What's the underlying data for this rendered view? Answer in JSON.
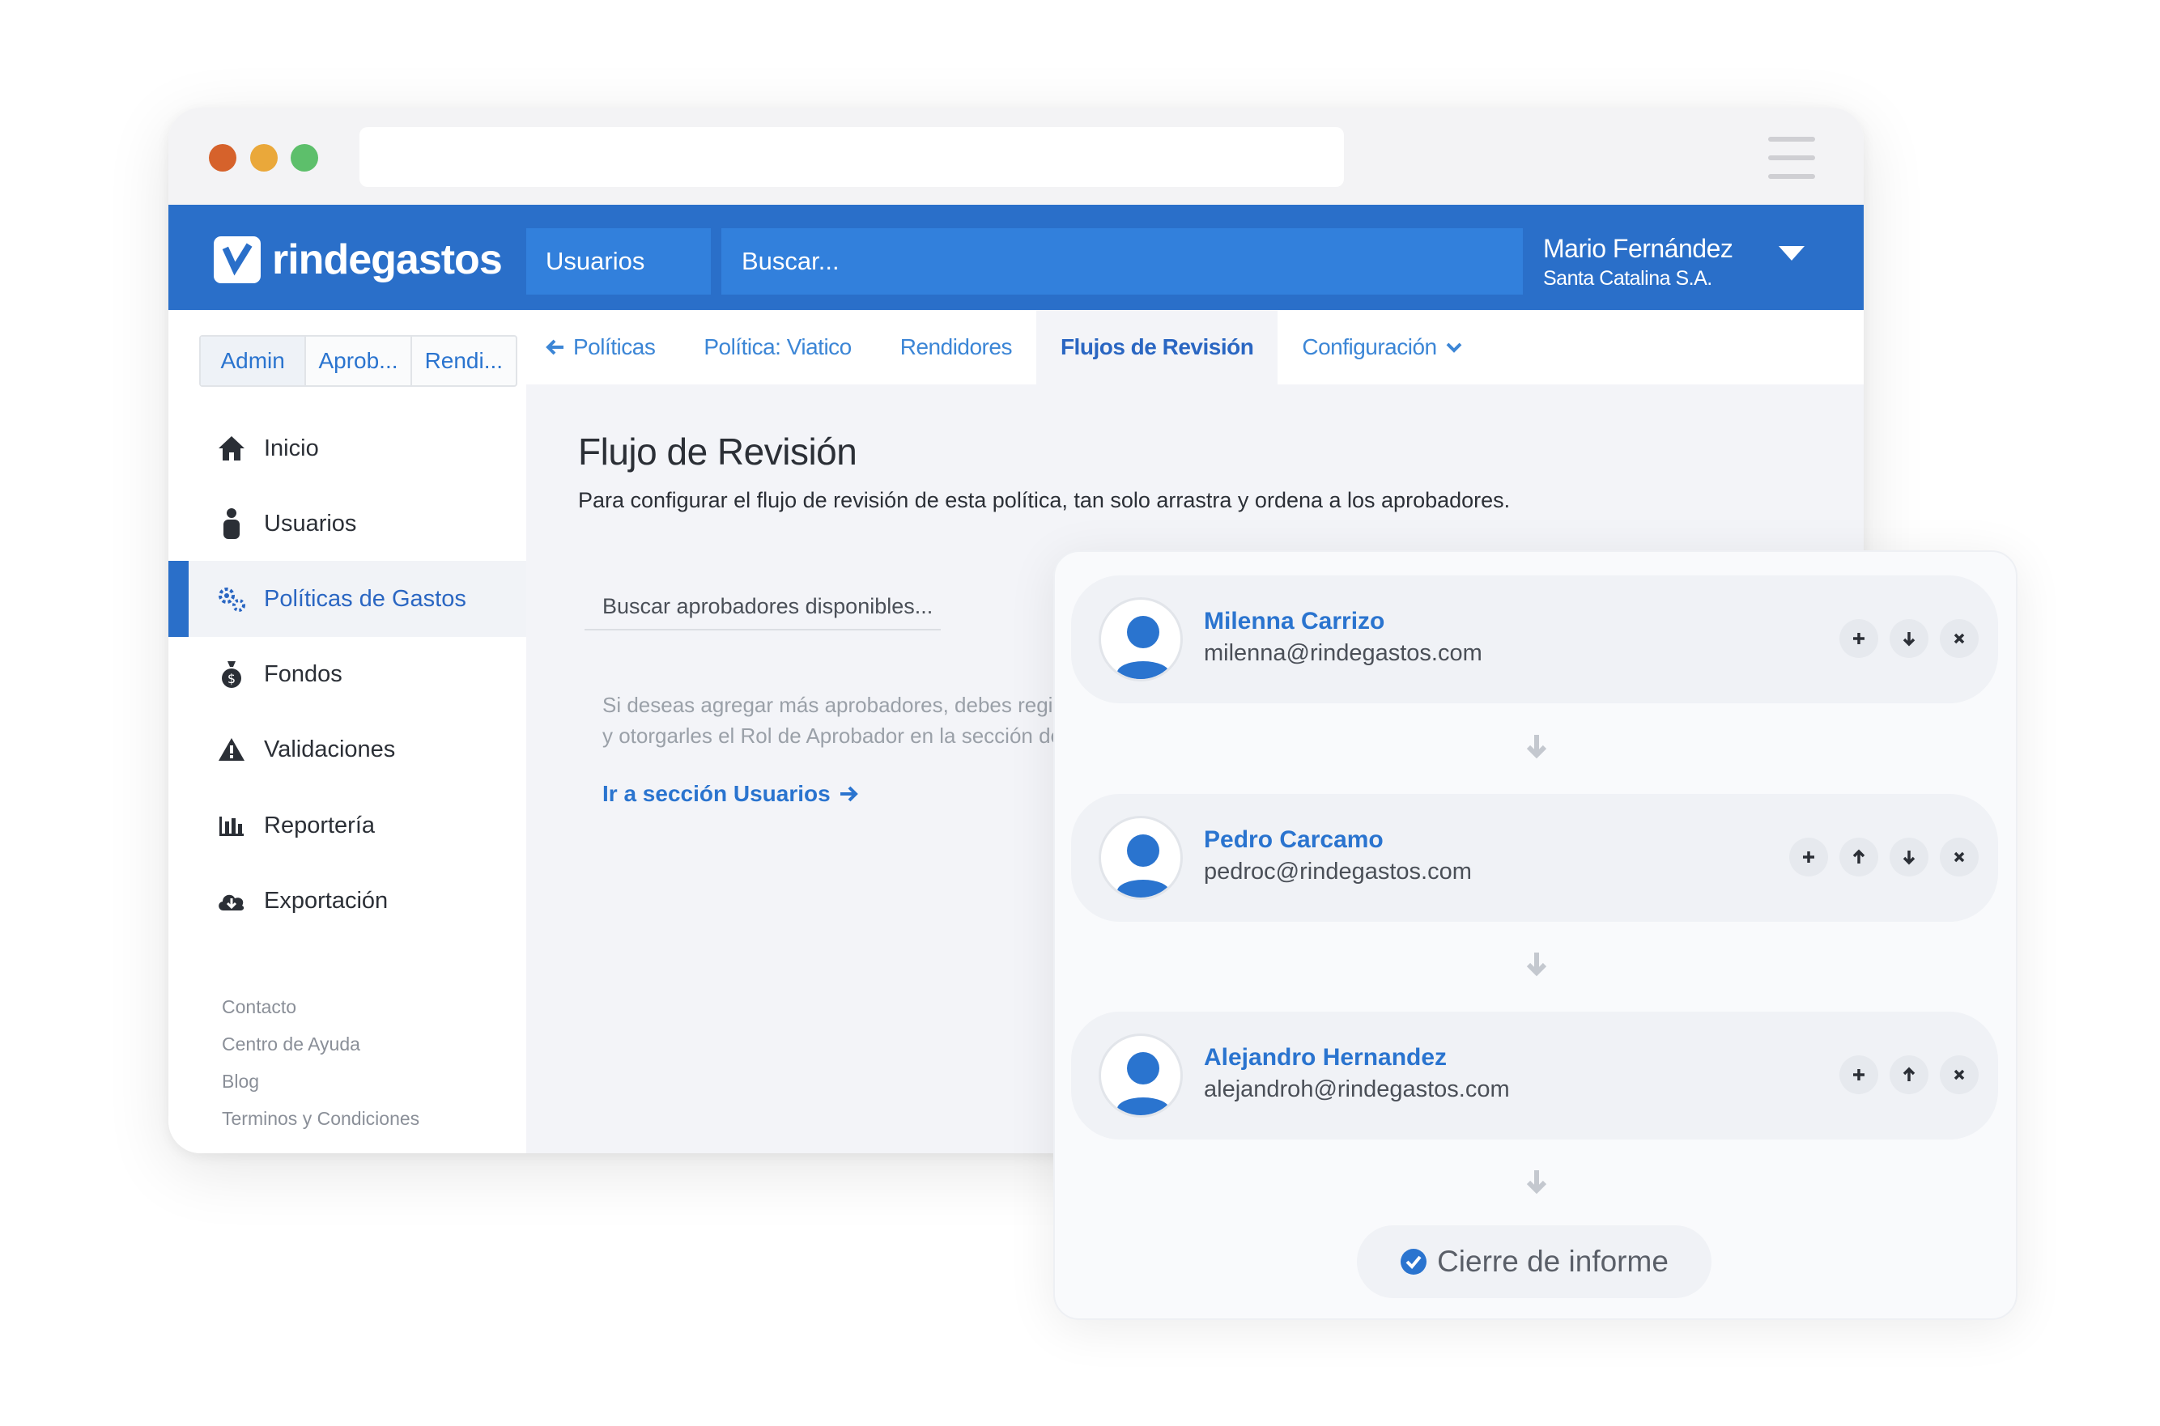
{
  "header": {
    "logo_text": "rindegastos",
    "tab_label": "Usuarios",
    "search_placeholder": "Buscar...",
    "user_name": "Mario Fernández",
    "user_company": "Santa Catalina S.A."
  },
  "sidebar": {
    "role_tabs": [
      "Admin",
      "Aprob...",
      "Rendi..."
    ],
    "active_role": "Admin",
    "items": [
      {
        "label": "Inicio",
        "icon": "home-icon"
      },
      {
        "label": "Usuarios",
        "icon": "user-icon"
      },
      {
        "label": "Políticas de Gastos",
        "icon": "gears-icon",
        "active": true
      },
      {
        "label": "Fondos",
        "icon": "money-bag-icon"
      },
      {
        "label": "Validaciones",
        "icon": "warning-icon"
      },
      {
        "label": "Reportería",
        "icon": "bar-chart-icon"
      },
      {
        "label": "Exportación",
        "icon": "cloud-download-icon"
      }
    ],
    "footer_links": [
      "Contacto",
      "Centro de Ayuda",
      "Blog",
      "Terminos y Condiciones"
    ]
  },
  "subnav": {
    "items": [
      "Políticas",
      "Política: Viatico",
      "Rendidores",
      "Flujos de Revisión",
      "Configuración"
    ],
    "active": "Flujos de Revisión"
  },
  "main": {
    "title": "Flujo de Revisión",
    "subtitle": "Para configurar el flujo de revisión de esta política, tan solo arrastra y ordena a los aprobadores.",
    "search_placeholder": "Buscar aprobadores disponibles...",
    "hint_line1": "Si deseas agregar más aprobadores, debes regis",
    "hint_line2": "y otorgarles el Rol de Aprobador en la sección de",
    "go_link": "Ir a sección Usuarios"
  },
  "flow": {
    "approvers": [
      {
        "name": "Milenna Carrizo",
        "email": "milenna@rindegastos.com",
        "actions": [
          "add",
          "move-down",
          "remove"
        ]
      },
      {
        "name": "Pedro Carcamo",
        "email": "pedroc@rindegastos.com",
        "actions": [
          "add",
          "move-up",
          "move-down",
          "remove"
        ]
      },
      {
        "name": "Alejandro Hernandez",
        "email": "alejandroh@rindegastos.com",
        "actions": [
          "add",
          "move-up",
          "remove"
        ]
      }
    ],
    "closing_label": "Cierre de informe"
  },
  "colors": {
    "brand": "#2a6fc9",
    "link": "#2a74cf",
    "window_dot_red": "#d6622b",
    "window_dot_yellow": "#eaa83a",
    "window_dot_green": "#5dbf6b"
  }
}
